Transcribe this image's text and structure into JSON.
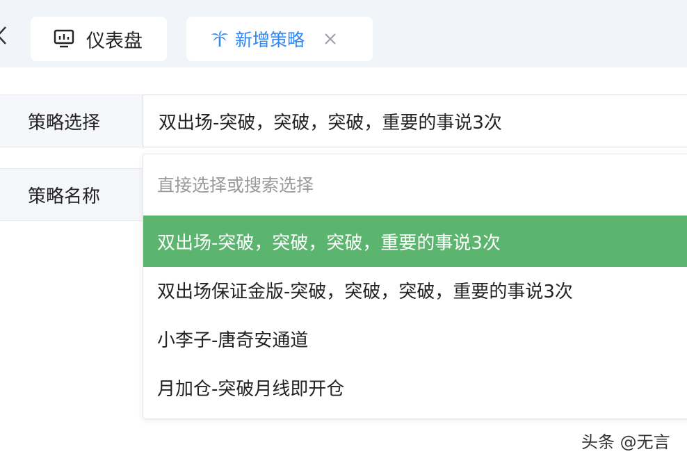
{
  "tabs": {
    "dashboard": {
      "label": "仪表盘",
      "icon": "monitor-chart-icon"
    },
    "new_strategy": {
      "label": "新增策略",
      "icon": "palm-tree-icon",
      "close_icon": "close-icon",
      "active_color": "#2f86f6"
    }
  },
  "form": {
    "strategy_select": {
      "label": "策略选择",
      "value": "双出场-突破，突破，突破，重要的事说3次"
    },
    "strategy_name": {
      "label": "策略名称"
    }
  },
  "dropdown": {
    "search_placeholder": "直接选择或搜索选择",
    "search_value": "",
    "selected_color": "#5cb56e",
    "options": [
      {
        "label": "双出场-突破，突破，突破，重要的事说3次",
        "selected": true
      },
      {
        "label": "双出场保证金版-突破，突破，突破，重要的事说3次",
        "selected": false
      },
      {
        "label": "小李子-唐奇安通道",
        "selected": false
      },
      {
        "label": "月加仓-突破月线即开仓",
        "selected": false
      }
    ]
  },
  "watermark": "头条 @无言"
}
